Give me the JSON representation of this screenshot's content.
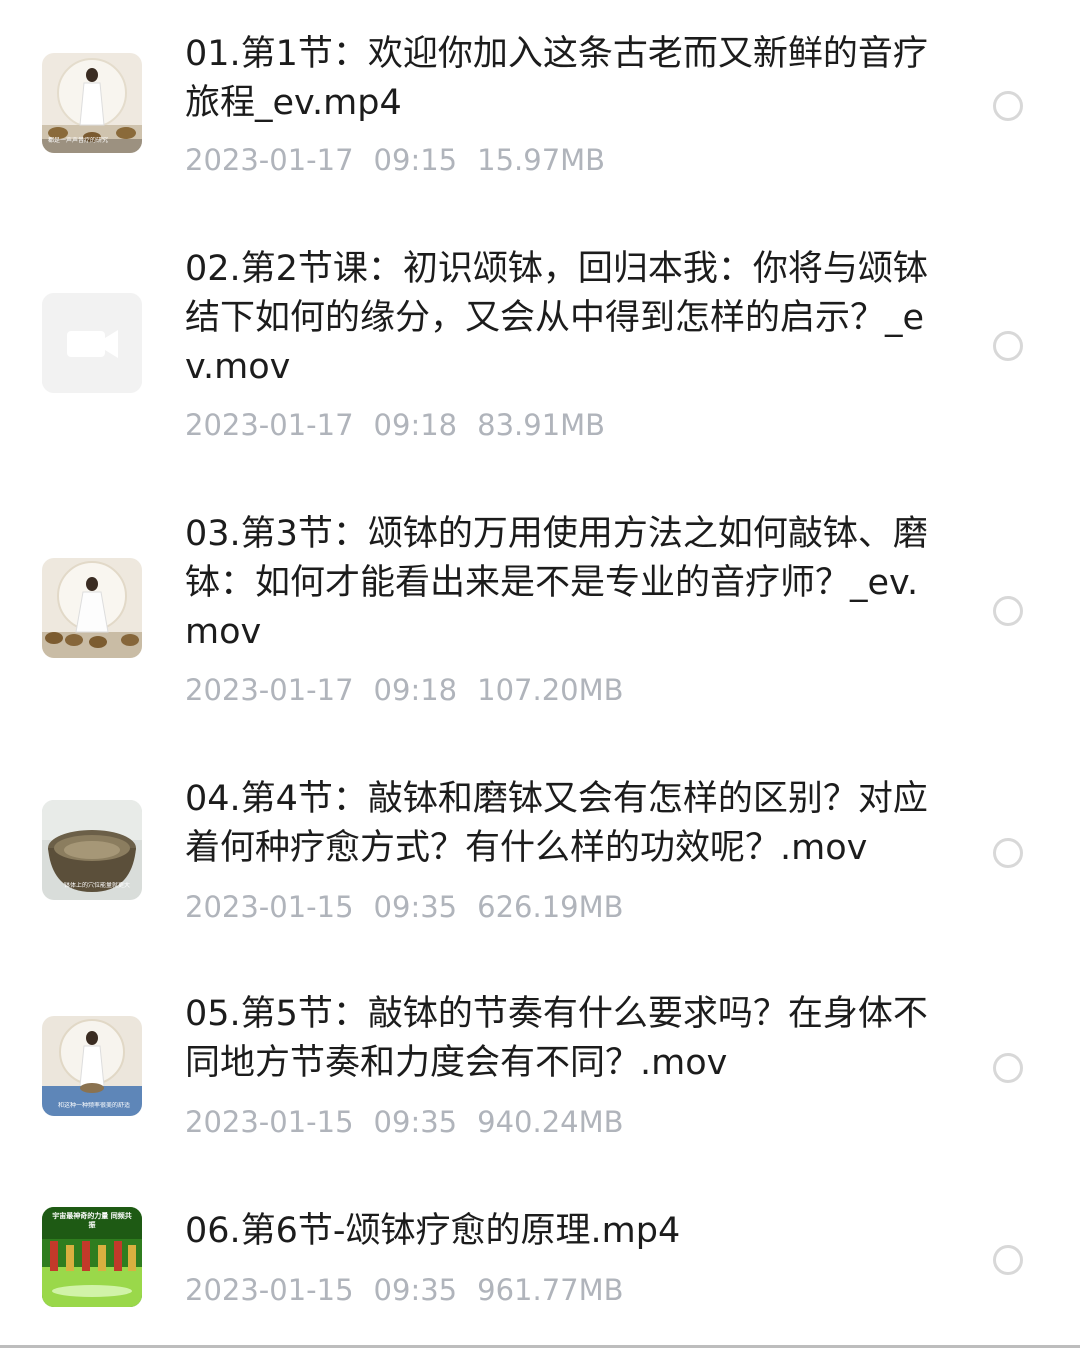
{
  "files": [
    {
      "name": "01.第1节：欢迎你加入这条古老而又新鲜的音疗旅程_ev.mp4",
      "date": "2023-01-17",
      "time": "09:15",
      "size": "15.97MB",
      "thumbnail": "video-thumbnail-woman-with-singing-bowls",
      "thumb_caption": "都是一声声音疗的研究"
    },
    {
      "name": "02.第2节课：初识颂钵，回归本我：你将与颂钵结下如何的缘分，又会从中得到怎样的启示？_ev.mov",
      "date": "2023-01-17",
      "time": "09:18",
      "size": "83.91MB",
      "thumbnail": "video-camera-placeholder-icon"
    },
    {
      "name": "03.第3节：颂钵的万用使用方法之如何敲钵、磨钵：如何才能看出来是不是专业的音疗师？_ev.mov",
      "date": "2023-01-17",
      "time": "09:18",
      "size": "107.20MB",
      "thumbnail": "video-thumbnail-woman-with-singing-bowls"
    },
    {
      "name": "04.第4节：敲钵和磨钵又会有怎样的区别？对应着何种疗愈方式？有什么样的功效呢？.mov",
      "date": "2023-01-15",
      "time": "09:35",
      "size": "626.19MB",
      "thumbnail": "video-thumbnail-singing-bowl-closeup",
      "thumb_caption": "钵体上的穴位能量就更大"
    },
    {
      "name": "05.第5节：敲钵的节奏有什么要求吗？在身体不同地方节奏和力度会有不同？.mov",
      "date": "2023-01-15",
      "time": "09:35",
      "size": "940.24MB",
      "thumbnail": "video-thumbnail-bowl-on-body",
      "thumb_caption": "和这种一种频率很美的舒适"
    },
    {
      "name": "06.第6节-颂钵疗愈的原理.mp4",
      "date": "2023-01-15",
      "time": "09:35",
      "size": "961.77MB",
      "thumbnail": "video-thumbnail-green-bowls-banner",
      "thumb_caption": "宇宙最神奇的力量 同频共振"
    }
  ]
}
